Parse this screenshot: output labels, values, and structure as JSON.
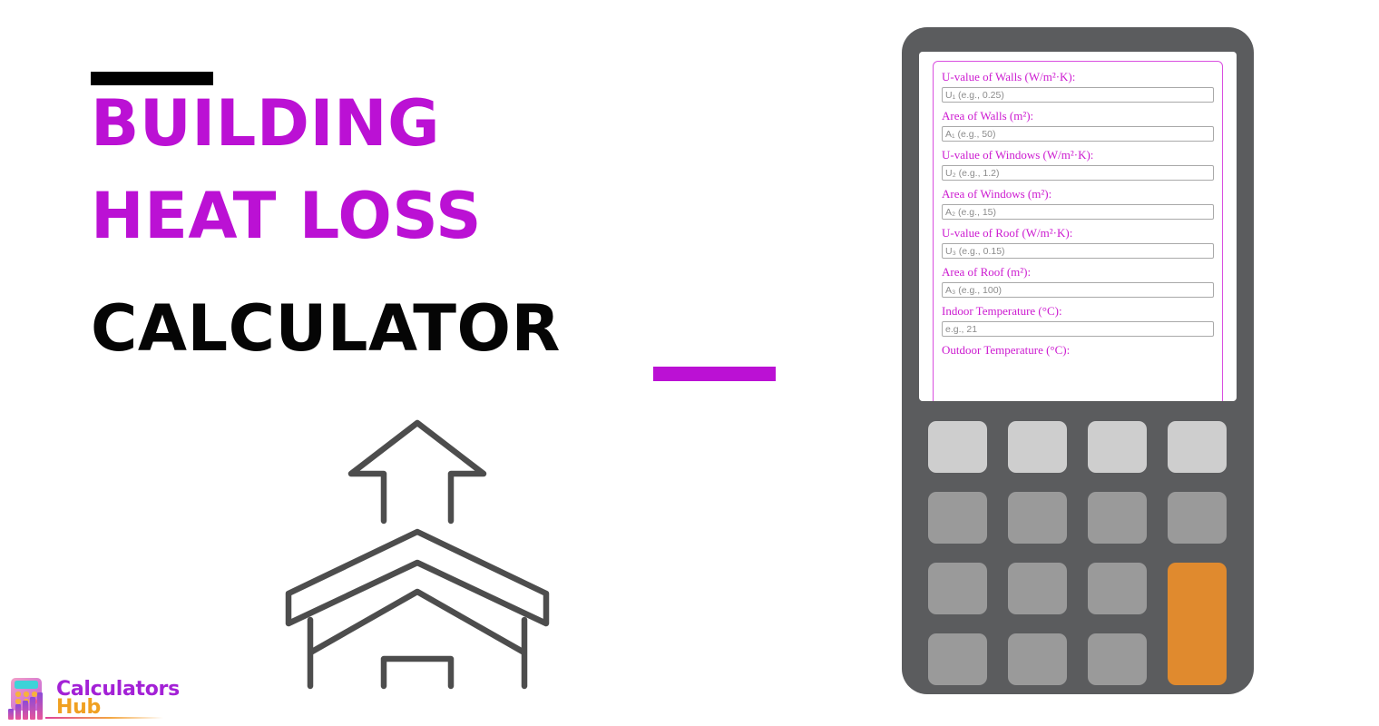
{
  "page": {
    "background": "#ffffff",
    "accent_magenta": "#bb11d4",
    "accent_orange": "#e08a2e",
    "body_gray": "#5b5c5e"
  },
  "hero": {
    "title_line_1": "BUILDING",
    "title_line_2": "HEAT LOSS",
    "title_line_3": "CALCULATOR",
    "illustration_name": "house-heat-loss-illustration"
  },
  "logo": {
    "text_top": "Calculators",
    "text_bottom": "Hub",
    "icon_name": "calculator-bar-chart-icon"
  },
  "calculator": {
    "screen": {
      "fields": [
        {
          "label": "U-value of Walls (W/m²·K):",
          "placeholder": "U₁ (e.g., 0.25)",
          "value": "",
          "name": "u-value-walls"
        },
        {
          "label": "Area of Walls (m²):",
          "placeholder": "A₁ (e.g., 50)",
          "value": "",
          "name": "area-walls"
        },
        {
          "label": "U-value of Windows (W/m²·K):",
          "placeholder": "U₂ (e.g., 1.2)",
          "value": "",
          "name": "u-value-windows"
        },
        {
          "label": "Area of Windows (m²):",
          "placeholder": "A₂ (e.g., 15)",
          "value": "",
          "name": "area-windows"
        },
        {
          "label": "U-value of Roof (W/m²·K):",
          "placeholder": "U₃ (e.g., 0.15)",
          "value": "",
          "name": "u-value-roof"
        },
        {
          "label": "Area of Roof (m²):",
          "placeholder": "A₃ (e.g., 100)",
          "value": "",
          "name": "area-roof"
        },
        {
          "label": "Indoor Temperature (°C):",
          "placeholder": "e.g., 21",
          "value": "",
          "name": "indoor-temperature"
        },
        {
          "label": "Outdoor Temperature (°C):",
          "placeholder": "",
          "value": "",
          "name": "outdoor-temperature"
        }
      ]
    },
    "keypad": {
      "keys": [
        {
          "label": "",
          "style": "light",
          "row": 1,
          "col": 1
        },
        {
          "label": "",
          "style": "light",
          "row": 1,
          "col": 2
        },
        {
          "label": "",
          "style": "light",
          "row": 1,
          "col": 3
        },
        {
          "label": "",
          "style": "light",
          "row": 1,
          "col": 4
        },
        {
          "label": "",
          "style": "gray",
          "row": 2,
          "col": 1
        },
        {
          "label": "",
          "style": "gray",
          "row": 2,
          "col": 2
        },
        {
          "label": "",
          "style": "gray",
          "row": 2,
          "col": 3
        },
        {
          "label": "",
          "style": "gray",
          "row": 2,
          "col": 4
        },
        {
          "label": "",
          "style": "gray",
          "row": 3,
          "col": 1
        },
        {
          "label": "",
          "style": "gray",
          "row": 3,
          "col": 2
        },
        {
          "label": "",
          "style": "gray",
          "row": 3,
          "col": 3
        },
        {
          "label": "",
          "style": "accent",
          "row": 3,
          "col": 4,
          "tall": true
        },
        {
          "label": "",
          "style": "gray",
          "row": 4,
          "col": 1
        },
        {
          "label": "",
          "style": "gray",
          "row": 4,
          "col": 2
        },
        {
          "label": "",
          "style": "gray",
          "row": 4,
          "col": 3
        }
      ]
    }
  }
}
